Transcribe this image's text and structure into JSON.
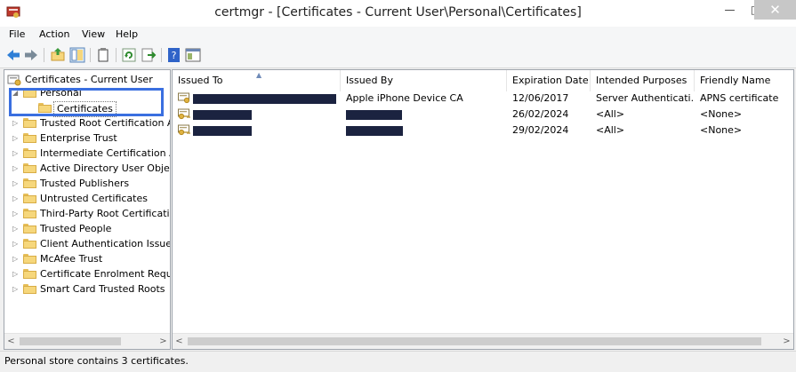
{
  "window": {
    "title": "certmgr - [Certificates - Current User\\Personal\\Certificates]",
    "min_glyph": "—",
    "max_glyph": "□",
    "close_glyph": "✕"
  },
  "menu": [
    "File",
    "Action",
    "View",
    "Help"
  ],
  "toolbar": {
    "icons": [
      "back-arrow-icon",
      "forward-arrow-icon",
      "up-folder-icon",
      "show-hide-tree-icon",
      "clipboard-icon",
      "refresh-icon",
      "export-list-icon",
      "help-icon",
      "properties-icon"
    ]
  },
  "tree": {
    "root": "Certificates - Current User",
    "items": [
      {
        "label": "Personal",
        "expander": "◢"
      },
      {
        "label": "Certificates",
        "expander": ""
      },
      {
        "label": "Trusted Root Certification Au",
        "expander": "▷"
      },
      {
        "label": "Enterprise Trust",
        "expander": "▷"
      },
      {
        "label": "Intermediate Certification Au",
        "expander": "▷"
      },
      {
        "label": "Active Directory User Object",
        "expander": "▷"
      },
      {
        "label": "Trusted Publishers",
        "expander": "▷"
      },
      {
        "label": "Untrusted Certificates",
        "expander": "▷"
      },
      {
        "label": "Third-Party Root Certification",
        "expander": "▷"
      },
      {
        "label": "Trusted People",
        "expander": "▷"
      },
      {
        "label": "Client Authentication Issuers",
        "expander": "▷"
      },
      {
        "label": "McAfee Trust",
        "expander": "▷"
      },
      {
        "label": "Certificate Enrolment Reques",
        "expander": "▷"
      },
      {
        "label": "Smart Card Trusted Roots",
        "expander": "▷"
      }
    ]
  },
  "list": {
    "columns": [
      "Issued To",
      "Issued By",
      "Expiration Date",
      "Intended Purposes",
      "Friendly Name"
    ],
    "rows": [
      {
        "issued_to": "",
        "issued_by": "Apple iPhone Device CA",
        "expiration": "12/06/2017",
        "purposes": "Server Authenticati...",
        "friendly": "APNS certificate"
      },
      {
        "issued_to": "",
        "issued_by": "",
        "expiration": "26/02/2024",
        "purposes": "<All>",
        "friendly": "<None>"
      },
      {
        "issued_to": "",
        "issued_by": "",
        "expiration": "29/02/2024",
        "purposes": "<All>",
        "friendly": "<None>"
      }
    ]
  },
  "scroll": {
    "left_glyph": "<",
    "right_glyph": ">"
  },
  "status": "Personal store contains 3 certificates.",
  "colors": {
    "highlight": "#3a6fe0",
    "redaction": "#1b2340"
  }
}
